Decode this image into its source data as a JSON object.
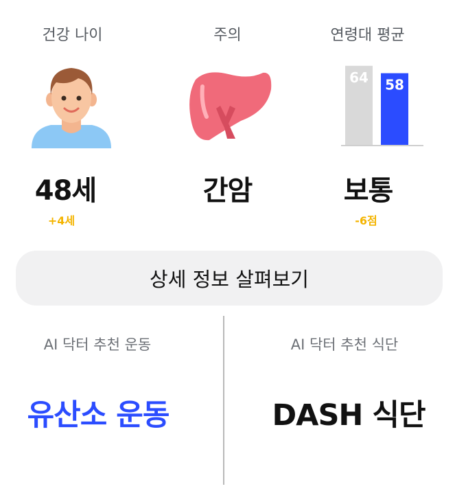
{
  "metrics": [
    {
      "label": "건강 나이",
      "value": "48세",
      "delta": "+4세",
      "icon": "person-avatar-icon"
    },
    {
      "label": "주의",
      "value": "간암",
      "icon": "liver-icon"
    },
    {
      "label": "연령대 평균",
      "value": "보통",
      "delta": "-6점",
      "icon": "score-bar-chart-icon"
    }
  ],
  "comparison_chart": {
    "type": "bar",
    "values": {
      "average": "64",
      "mine": "58"
    },
    "colors": {
      "average": "#d9d9d9",
      "mine": "#2b4cff"
    }
  },
  "detail_button": {
    "label": "상세 정보 살펴보기"
  },
  "recommendations": [
    {
      "label": "AI 닥터 추천 운동",
      "value": "유산소 운동"
    },
    {
      "label": "AI 닥터 추천 식단",
      "value": "DASH 식단"
    }
  ],
  "colors": {
    "accent": "#2b4cff",
    "delta": "#f4b400",
    "label": "#555a60",
    "button_bg": "#f1f1f2"
  }
}
